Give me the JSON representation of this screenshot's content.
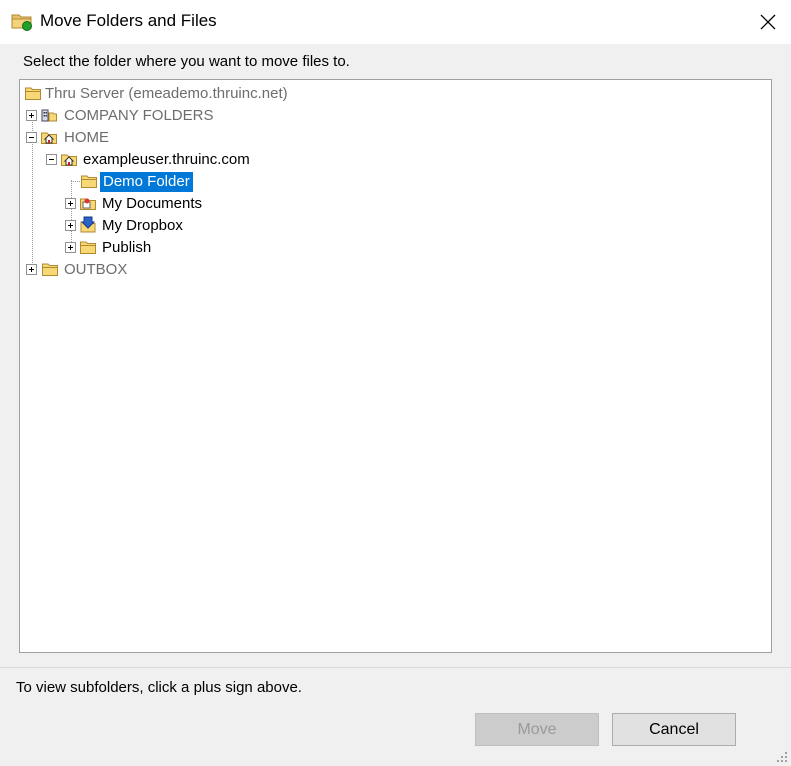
{
  "window": {
    "title": "Move Folders and Files",
    "close_label": "×"
  },
  "dialog": {
    "instruction": "Select the folder where you want to move files to.",
    "hint": "To view subfolders, click a plus sign above."
  },
  "tree": {
    "nodes": [
      {
        "label": "Thru Server (emeademo.thruinc.net)",
        "icon": "server-folder-icon",
        "expander": "none",
        "style": "gray"
      },
      {
        "label": "COMPANY FOLDERS",
        "icon": "company-folders-icon",
        "expander": "plus",
        "style": "gray"
      },
      {
        "label": "HOME",
        "icon": "home-folder-icon",
        "expander": "minus",
        "style": "gray"
      },
      {
        "label": "exampleuser.thruinc.com",
        "icon": "user-home-icon",
        "expander": "minus",
        "style": "normal"
      },
      {
        "label": "Demo Folder",
        "icon": "folder-icon",
        "expander": "none",
        "style": "selected"
      },
      {
        "label": "My Documents",
        "icon": "my-documents-icon",
        "expander": "plus",
        "style": "normal"
      },
      {
        "label": "My Dropbox",
        "icon": "dropbox-icon",
        "expander": "plus",
        "style": "normal"
      },
      {
        "label": "Publish",
        "icon": "folder-icon",
        "expander": "plus",
        "style": "normal"
      },
      {
        "label": "OUTBOX",
        "icon": "folder-icon",
        "expander": "plus",
        "style": "gray"
      }
    ]
  },
  "buttons": {
    "move_label": "Move",
    "cancel_label": "Cancel"
  },
  "colors": {
    "selection": "#0078d7",
    "folder": "#f8d775",
    "folder_edge": "#c9a43a"
  }
}
